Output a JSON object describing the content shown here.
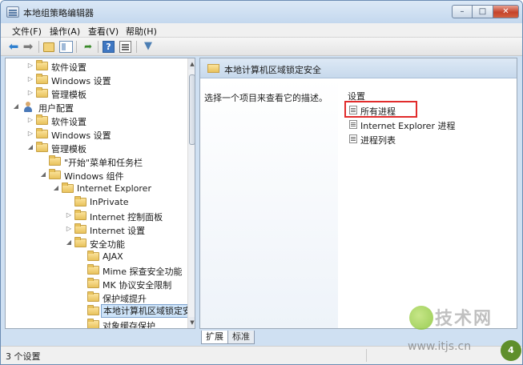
{
  "window": {
    "title": "本地组策略编辑器",
    "controls": {
      "minimize": "–",
      "maximize": "□",
      "close": "✕"
    }
  },
  "menu": {
    "items": [
      {
        "label": "文件(F)"
      },
      {
        "label": "操作(A)"
      },
      {
        "label": "查看(V)"
      },
      {
        "label": "帮助(H)"
      }
    ]
  },
  "toolbar": {
    "icons": [
      "back-arrow-icon",
      "forward-arrow-icon",
      "folder-up-icon",
      "show-hide-tree-icon",
      "export-list-icon",
      "help-icon",
      "properties-icon",
      "filter-icon"
    ]
  },
  "tree": {
    "items": [
      {
        "label": "软件设置",
        "expander": "▷"
      },
      {
        "label": "Windows 设置",
        "expander": "▷"
      },
      {
        "label": "管理模板",
        "expander": "▷"
      },
      {
        "label": "用户配置",
        "expander": "◢"
      },
      {
        "label": "软件设置",
        "expander": "▷"
      },
      {
        "label": "Windows 设置",
        "expander": "▷"
      },
      {
        "label": "管理模板",
        "expander": "◢"
      },
      {
        "label": "\"开始\"菜单和任务栏",
        "expander": ""
      },
      {
        "label": "Windows 组件",
        "expander": "◢"
      },
      {
        "label": "Internet Explorer",
        "expander": "◢"
      },
      {
        "label": "InPrivate",
        "expander": ""
      },
      {
        "label": "Internet 控制面板",
        "expander": "▷"
      },
      {
        "label": "Internet 设置",
        "expander": "▷"
      },
      {
        "label": "安全功能",
        "expander": "◢"
      },
      {
        "label": "AJAX",
        "expander": ""
      },
      {
        "label": "Mime 探查安全功能",
        "expander": ""
      },
      {
        "label": "MK 协议安全限制",
        "expander": ""
      },
      {
        "label": "保护域提升",
        "expander": ""
      },
      {
        "label": "本地计算机区域锁定安全",
        "expander": ""
      },
      {
        "label": "对象缓存保护",
        "expander": ""
      }
    ],
    "scroll_up": "▲",
    "scroll_down": "▼"
  },
  "details": {
    "header_title": "本地计算机区域锁定安全",
    "description": "选择一个项目来查看它的描述。",
    "settings_header": "设置",
    "settings": [
      {
        "label": "所有进程"
      },
      {
        "label": "Internet Explorer 进程"
      },
      {
        "label": "进程列表"
      }
    ]
  },
  "tabs": [
    {
      "label": "扩展"
    },
    {
      "label": "标准"
    }
  ],
  "status": {
    "text": "3 个设置"
  },
  "watermark": {
    "brand": "技术网",
    "url": "www.itjs.cn"
  },
  "colors": {
    "highlight": "#e12b2b",
    "header_bg": "#c7d9ec",
    "selection": "#cde3f8"
  }
}
